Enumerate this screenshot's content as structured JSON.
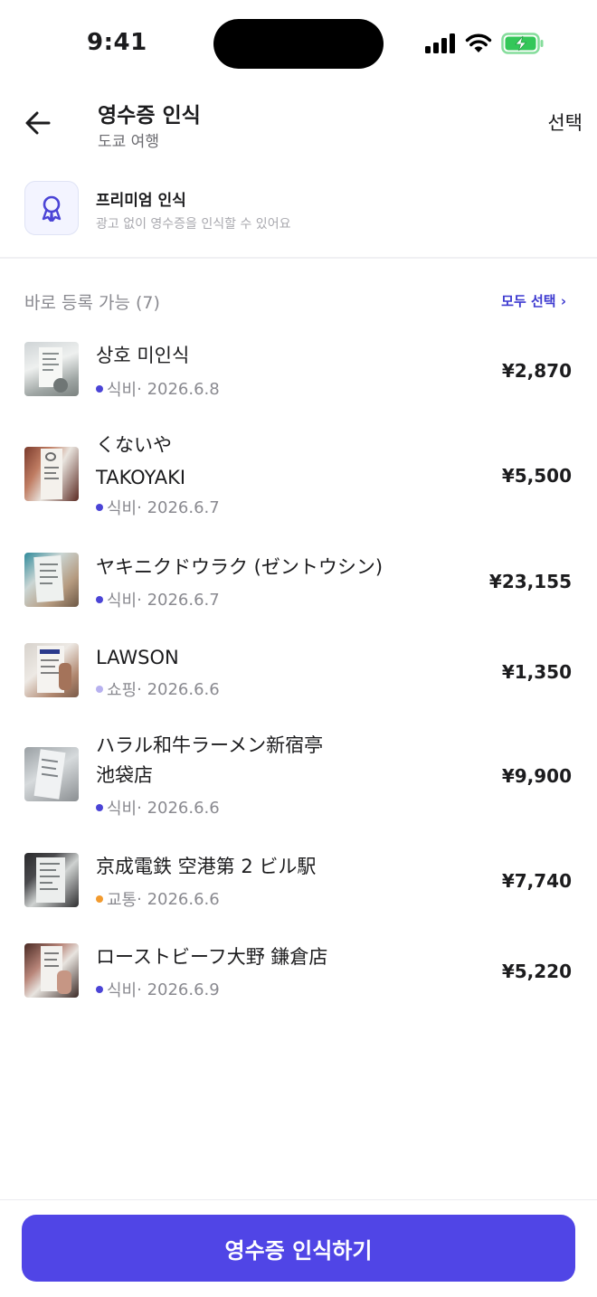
{
  "status_bar": {
    "time": "9:41"
  },
  "header": {
    "title": "영수증 인식",
    "subtitle": "도쿄 여행",
    "select_label": "선택"
  },
  "premium": {
    "title": "프리미엄 인식",
    "description": "광고 없이 영수증을 인식할 수 있어요"
  },
  "section": {
    "title": "바로 등록 가능 (7)",
    "select_all_label": "모두 선택 ›"
  },
  "receipts": [
    {
      "name1": "상호 미인식",
      "name2": "",
      "category": "식비",
      "date": "· 2026.6.8",
      "amount": "¥2,870",
      "dot_color": "#4b44d6"
    },
    {
      "name1": "くないや",
      "name2": "TAKOYAKI",
      "category": "식비",
      "date": "· 2026.6.7",
      "amount": "¥5,500",
      "dot_color": "#4b44d6"
    },
    {
      "name1": "ヤキニクドウラク (ゼントウシン)",
      "name2": "",
      "category": "식비",
      "date": "· 2026.6.7",
      "amount": "¥23,155",
      "dot_color": "#4b44d6"
    },
    {
      "name1": "LAWSON",
      "name2": "",
      "category": "쇼핑",
      "date": "· 2026.6.6",
      "amount": "¥1,350",
      "dot_color": "#b7b1ef"
    },
    {
      "name1": "ハラル和牛ラーメン新宿亭",
      "name2": "池袋店",
      "category": "식비",
      "date": "· 2026.6.6",
      "amount": "¥9,900",
      "dot_color": "#4b44d6"
    },
    {
      "name1": "京成電鉄 空港第 2 ビル駅",
      "name2": "",
      "category": "교통",
      "date": "· 2026.6.6",
      "amount": "¥7,740",
      "dot_color": "#f29a2e"
    },
    {
      "name1": "ローストビーフ大野 鎌倉店",
      "name2": "",
      "category": "식비",
      "date": "· 2026.6.9",
      "amount": "¥5,220",
      "dot_color": "#4b44d6"
    }
  ],
  "footer": {
    "cta_label": "영수증 인식하기"
  },
  "colors": {
    "accent": "#5045e6",
    "link": "#3d3ad0"
  },
  "icons": [
    "back-arrow-icon",
    "award-ribbon-icon",
    "cellular-signal-icon",
    "wifi-icon",
    "battery-charging-icon"
  ]
}
